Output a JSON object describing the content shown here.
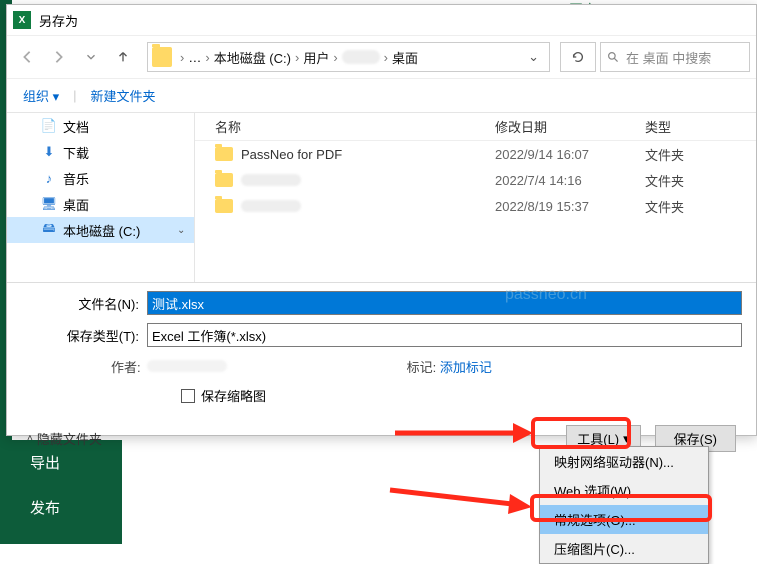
{
  "background": {
    "pinned_label": "已固定",
    "export_label": "导出",
    "publish_label": "发布"
  },
  "dialog": {
    "title": "另存为",
    "breadcrumb": {
      "drive": "本地磁盘 (C:)",
      "users": "用户",
      "desktop": "桌面"
    },
    "search_placeholder": "在 桌面 中搜索",
    "toolbar": {
      "organize": "组织",
      "new_folder": "新建文件夹"
    },
    "sidebar": {
      "documents": "文档",
      "downloads": "下载",
      "music": "音乐",
      "desktop": "桌面",
      "drive": "本地磁盘 (C:)"
    },
    "columns": {
      "name": "名称",
      "date": "修改日期",
      "type": "类型"
    },
    "rows": [
      {
        "name": "PassNeo for PDF",
        "date": "2022/9/14 16:07",
        "type": "文件夹"
      },
      {
        "name": "",
        "date": "2022/7/4 14:16",
        "type": "文件夹"
      },
      {
        "name": "",
        "date": "2022/8/19 15:37",
        "type": "文件夹"
      }
    ],
    "form": {
      "filename_label": "文件名(N):",
      "filename_value": "测试.xlsx",
      "savetype_label": "保存类型(T):",
      "savetype_value": "Excel 工作簿(*.xlsx)",
      "author_label": "作者:",
      "tags_label": "标记:",
      "add_tag": "添加标记",
      "save_thumb": "保存缩略图"
    },
    "bottom": {
      "hide_folders": "隐藏文件夹",
      "tools": "工具(L)",
      "save": "保存(S)"
    }
  },
  "dropdown": {
    "map_drive": "映射网络驱动器(N)...",
    "web_options": "Web 选项(W)...",
    "general_options": "常规选项(G)...",
    "compress_pics": "压缩图片(C)..."
  },
  "watermark": "passneo.cn"
}
